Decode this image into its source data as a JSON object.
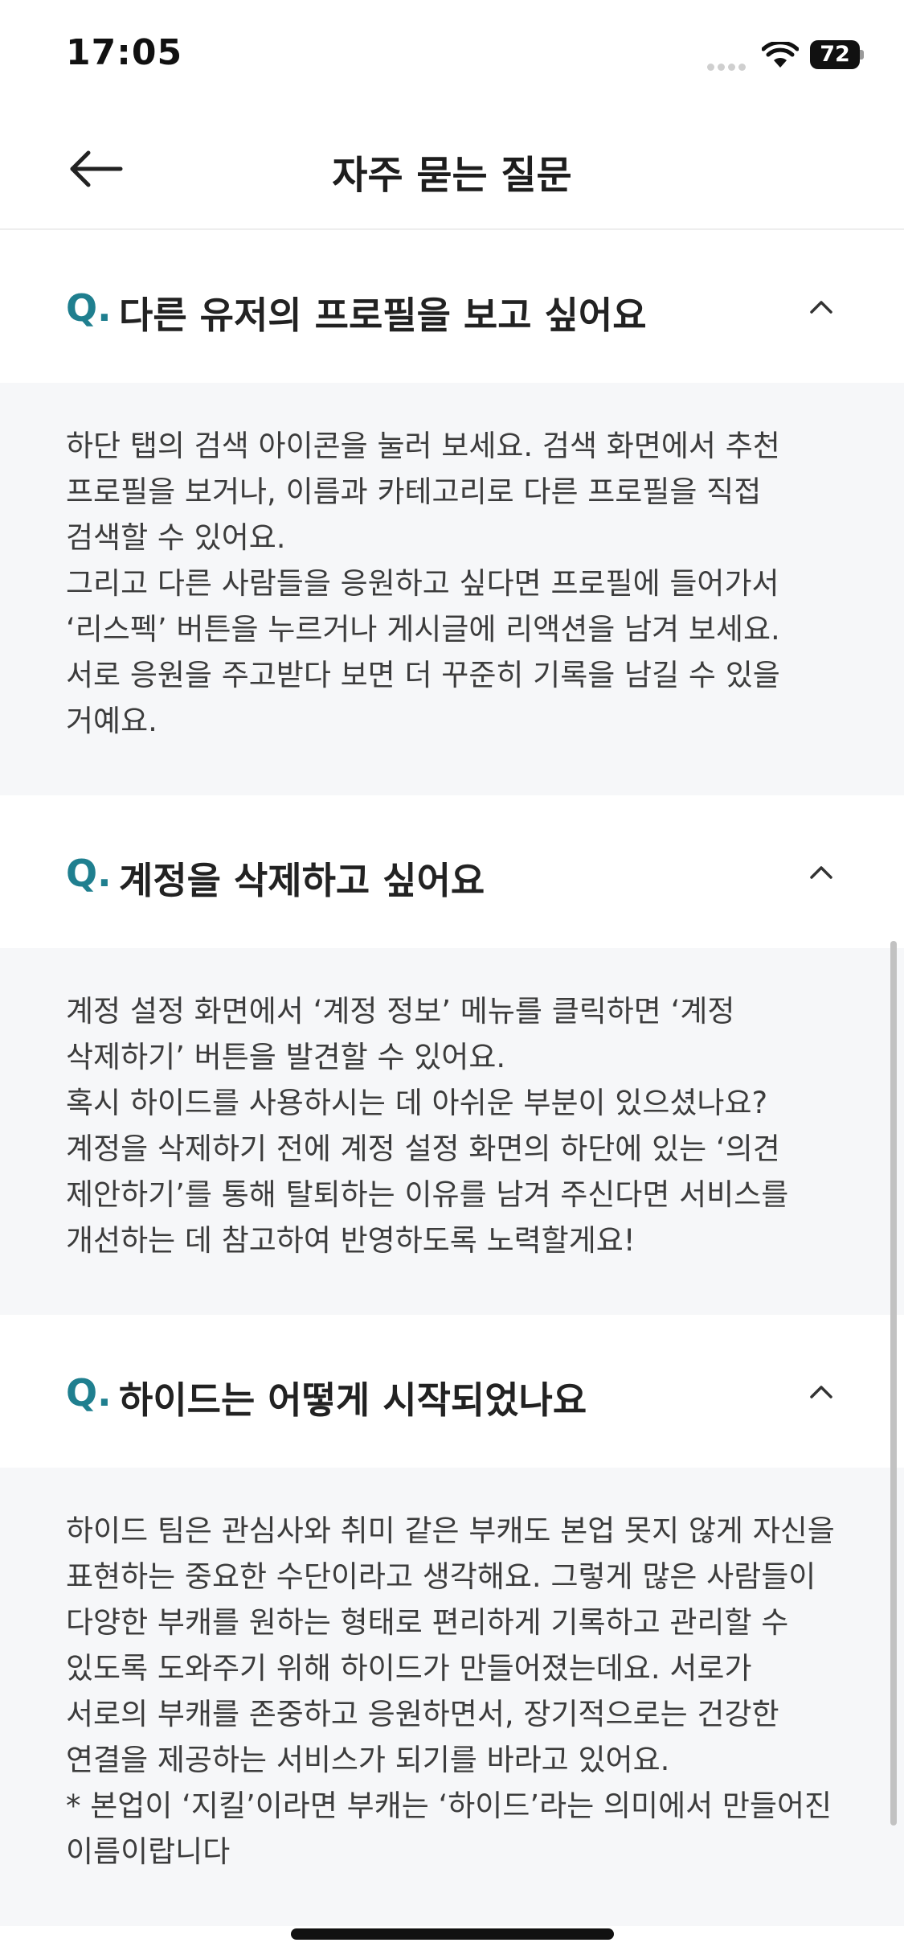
{
  "status_bar": {
    "time": "17:05",
    "battery": "72",
    "icons": [
      "signal-icon",
      "wifi-icon",
      "battery-icon"
    ]
  },
  "header": {
    "back_icon": "arrow-left-icon",
    "title": "자주 묻는 질문"
  },
  "faq": {
    "q_prefix": "Q.",
    "items": [
      {
        "question": "다른 유저의 프로필을 보고 싶어요",
        "answer": "하단 탭의 검색 아이콘을 눌러 보세요. 검색 화면에서 추천 프로필을 보거나, 이름과 카테고리로 다른 프로필을 직접 검색할 수 있어요.\n그리고 다른 사람들을 응원하고 싶다면 프로필에 들어가서 ‘리스펙’ 버튼을 누르거나 게시글에 리액션을 남겨 보세요. 서로 응원을 주고받다 보면 더 꾸준히 기록을 남길 수 있을 거예요.",
        "toggle_icon": "chevron-up-icon"
      },
      {
        "question": "계정을 삭제하고 싶어요",
        "answer": "계정 설정 화면에서 ‘계정 정보’ 메뉴를 클릭하면 ‘계정 삭제하기’ 버튼을 발견할 수 있어요.\n혹시 하이드를 사용하시는 데 아쉬운 부분이 있으셨나요? 계정을 삭제하기 전에 계정 설정 화면의 하단에 있는 ‘의견 제안하기’를 통해 탈퇴하는 이유를 남겨 주신다면 서비스를 개선하는 데 참고하여 반영하도록 노력할게요!",
        "toggle_icon": "chevron-up-icon"
      },
      {
        "question": "하이드는 어떻게 시작되었나요",
        "answer": "하이드 팀은 관심사와 취미 같은 부캐도 본업 못지 않게 자신을 표현하는 중요한 수단이라고 생각해요. 그렇게 많은 사람들이 다양한 부캐를 원하는 형태로 편리하게 기록하고 관리할 수 있도록 도와주기 위해 하이드가 만들어졌는데요. 서로가 서로의 부캐를 존중하고 응원하면서, 장기적으로는 건강한 연결을 제공하는 서비스가 되기를 바라고 있어요.\n* 본업이 ‘지킬’이라면 부캐는 ‘하이드’라는 의미에서 만들어진 이름이랍니다",
        "toggle_icon": "chevron-up-icon"
      }
    ]
  },
  "colors": {
    "accent": "#1f7f8f",
    "answer_background": "#f6f7f9",
    "text": "#222222"
  }
}
